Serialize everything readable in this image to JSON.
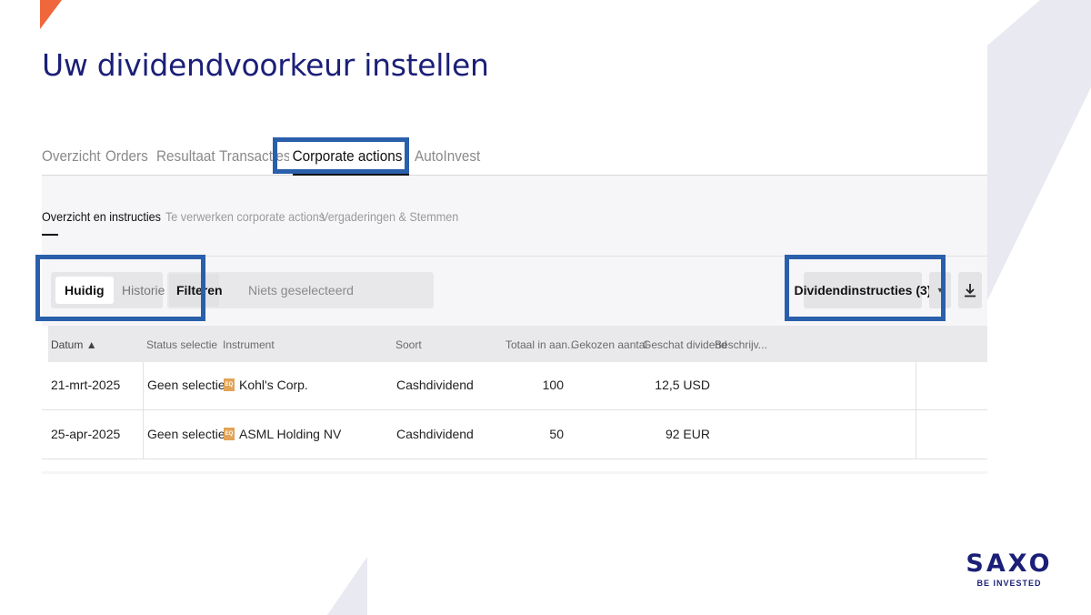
{
  "slide": {
    "title": "Uw dividendvoorkeur instellen"
  },
  "top_tabs": [
    {
      "label": "Overzicht"
    },
    {
      "label": "Orders"
    },
    {
      "label": "Resultaat"
    },
    {
      "label": "Transacties"
    },
    {
      "label": "Corporate actions",
      "active": true
    },
    {
      "label": "AutoInvest"
    }
  ],
  "sub_tabs": [
    {
      "label": "Overzicht en instructies",
      "active": true
    },
    {
      "label": "Te verwerken corporate actions"
    },
    {
      "label": "Vergaderingen & Stemmen"
    }
  ],
  "toggle": {
    "current": "Huidig",
    "history": "Historie"
  },
  "filter": {
    "label": "Filteren",
    "value": "Niets geselecteerd"
  },
  "actions": {
    "dividend_instructions": "Dividendinstructies (3)"
  },
  "table": {
    "columns": [
      "Datum",
      "Status selectie",
      "Instrument",
      "Soort",
      "Totaal in aan...",
      "Gekozen aantal",
      "Geschat dividend",
      "Beschrijv..."
    ],
    "rows": [
      {
        "date": "21-mrt-2025",
        "status": "Geen selectie",
        "instrument": "Kohl's Corp.",
        "type": "Cashdividend",
        "total": "100",
        "chosen": "",
        "dividend": "12,5 USD"
      },
      {
        "date": "25-apr-2025",
        "status": "Geen selectie",
        "instrument": "ASML Holding NV",
        "type": "Cashdividend",
        "total": "50",
        "chosen": "",
        "dividend": "92 EUR"
      }
    ]
  },
  "logo": {
    "text": "SAXO",
    "tagline": "BE INVESTED"
  },
  "colors": {
    "brand_navy": "#1b1f77",
    "highlight_blue": "#2a5fab",
    "accent_orange": "#f0673c",
    "deco_gray": "#e8e9f1"
  }
}
